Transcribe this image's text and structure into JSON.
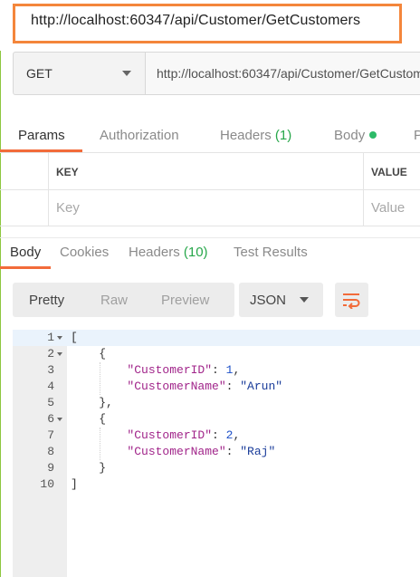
{
  "window": {
    "url_title": "http://localhost:60347/api/Customer/GetCustomers"
  },
  "request": {
    "method": "GET",
    "url": "http://localhost:60347/api/Customer/GetCustomers"
  },
  "request_tabs": [
    {
      "label": "Params",
      "active": true
    },
    {
      "label": "Authorization"
    },
    {
      "label": "Headers",
      "count": "(1)"
    },
    {
      "label": "Body",
      "dot": true
    },
    {
      "label": "P"
    }
  ],
  "params_table": {
    "headers": {
      "key": "KEY",
      "value": "VALUE"
    },
    "placeholders": {
      "key": "Key",
      "value": "Value"
    }
  },
  "response_tabs": [
    {
      "label": "Body",
      "active": true
    },
    {
      "label": "Cookies"
    },
    {
      "label": "Headers",
      "count": "(10)"
    },
    {
      "label": "Test Results"
    }
  ],
  "response_toolbar": {
    "formats": [
      "Pretty",
      "Raw",
      "Preview"
    ],
    "active_format": "Pretty",
    "language": "JSON",
    "wrap_icon": "wrap-lines-icon"
  },
  "response_body": {
    "line_numbers": [
      "1",
      "2",
      "3",
      "4",
      "5",
      "6",
      "7",
      "8",
      "9",
      "10"
    ],
    "customers": [
      {
        "id_key": "\"CustomerID\"",
        "id_value": "1",
        "name_key": "\"CustomerName\"",
        "name_value": "\"Arun\""
      },
      {
        "id_key": "\"CustomerID\"",
        "id_value": "2",
        "name_key": "\"CustomerName\"",
        "name_value": "\"Raj\""
      }
    ]
  },
  "colors": {
    "accent": "#f26b3a",
    "highlight_border": "#f4863b",
    "count_green": "#27a74a",
    "json_key": "#a1258a",
    "json_number": "#1e50c8",
    "json_string": "#1a3c9a"
  }
}
